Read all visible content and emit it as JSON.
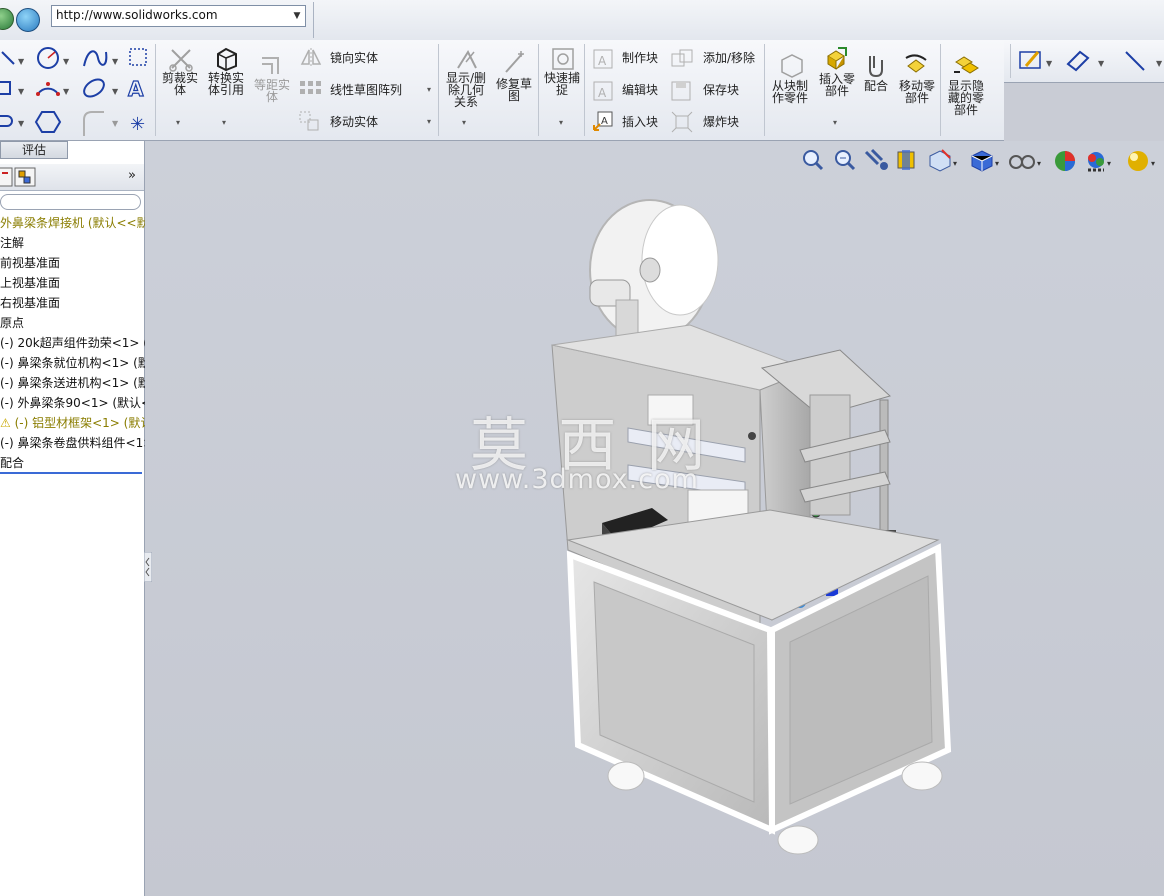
{
  "browser": {
    "url": "http://www.solidworks.com"
  },
  "toolbar": {
    "trim_label": "剪裁实体",
    "convert_label": "转换实体引用",
    "offset_label": "等距实体",
    "mirror_label": "镜向实体",
    "linear_pattern_label": "线性草图阵列",
    "move_entity_label": "移动实体",
    "display_delete_label": "显示/删除几何关系",
    "repair_sketch_label": "修复草图",
    "quick_snap_label": "快速捕捉",
    "make_block_label": "制作块",
    "edit_block_label": "编辑块",
    "insert_block_label": "插入块",
    "add_remove_label": "添加/移除",
    "save_block_label": "保存块",
    "explode_block_label": "爆炸块",
    "make_part_from_block_label": "从块制作零件",
    "insert_component_label": "插入零部件",
    "mate_label": "配合",
    "move_component_label": "移动零部件",
    "show_hidden_label": "显示隐藏的零部件"
  },
  "left_panel": {
    "tab_evaluate": "评估",
    "expand_chevron": "»",
    "tree": [
      {
        "label": "外鼻梁条焊接机 (默认<<默",
        "style": "root"
      },
      {
        "label": "注解",
        "style": "normal"
      },
      {
        "label": "前视基准面",
        "style": "normal"
      },
      {
        "label": "上视基准面",
        "style": "normal"
      },
      {
        "label": "右视基准面",
        "style": "normal"
      },
      {
        "label": "原点",
        "style": "normal"
      },
      {
        "label": "(-) 20k超声组件劲荣<1> (",
        "style": "normal"
      },
      {
        "label": "(-) 鼻梁条就位机构<1> (默",
        "style": "normal"
      },
      {
        "label": "(-) 鼻梁条送进机构<1> (默",
        "style": "normal"
      },
      {
        "label": "(-) 外鼻梁条90<1> (默认<",
        "style": "normal"
      },
      {
        "label": "(-) 铝型材框架<1> (默认",
        "style": "warning"
      },
      {
        "label": "(-) 鼻梁条卷盘供料组件<1>",
        "style": "normal"
      },
      {
        "label": "配合",
        "style": "normal"
      }
    ]
  },
  "watermark": {
    "title": "莫 西 网",
    "url": "www.3dmox.com"
  },
  "colors": {
    "viewport_bg": "#c9ccd5",
    "selection_line": "#3a6ad6",
    "warning_text": "#8a7d00"
  }
}
